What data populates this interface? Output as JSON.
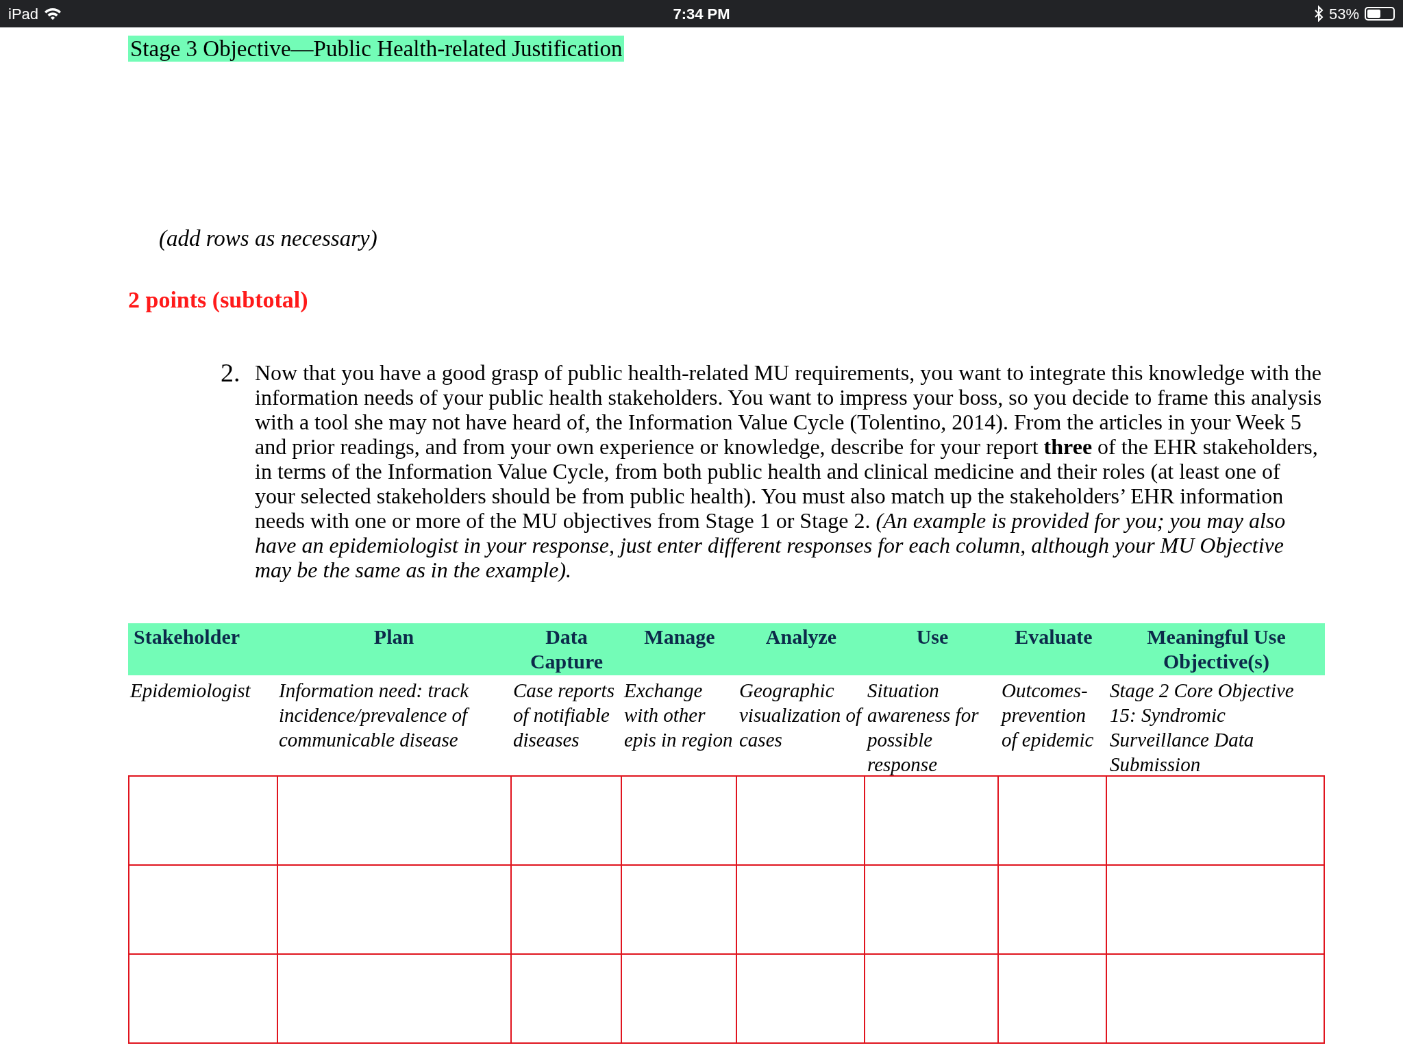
{
  "status_bar": {
    "device": "iPad",
    "time": "7:34 PM",
    "battery": "53%"
  },
  "heading": "Stage 3 Objective—Public Health-related Justification",
  "note": "(add rows as necessary)",
  "points": "2 points (subtotal)",
  "question": {
    "number": "2.",
    "text": "Now that you have a good grasp of public health-related MU requirements, you want to integrate this knowledge with the information needs of your public health stakeholders. You want to impress your boss, so you decide to frame this analysis with a tool she may not have heard of, the Information Value Cycle (Tolentino, 2014). From the articles in your Week 5 and prior readings, and from your own experience or knowledge, describe for your report **three** of the EHR stakeholders, in terms of the Information Value Cycle, from both public health and clinical medicine and their roles (at least one of your selected stakeholders should be from public health). You must also match up the stakeholders’ EHR information needs with one or more of the MU objectives from Stage 1 or Stage 2. *(An example is provided for you; you may also have an epidemiologist in your response, just enter different responses for each column, although your MU Objective may be the same as in the example).*"
  },
  "table": {
    "columns": [
      "Stakeholder",
      "Plan",
      "Data Capture",
      "Manage",
      "Analyze",
      "Use",
      "Evaluate",
      "Meaningful Use Objective(s)"
    ],
    "rows": [
      {
        "kind": "example",
        "cells": [
          "Epidemiologist",
          "Information need: track incidence/prevalence of communicable disease",
          "Case reports of notifiable diseases",
          "Exchange with other epis in region",
          "Geographic visualization of cases",
          "Situation awareness for possible response",
          "Outcomes-prevention of epidemic",
          "Stage 2 Core Objective 15: Syndromic Surveillance Data Submission"
        ]
      },
      {
        "kind": "blank"
      },
      {
        "kind": "blank"
      },
      {
        "kind": "blank"
      }
    ]
  }
}
